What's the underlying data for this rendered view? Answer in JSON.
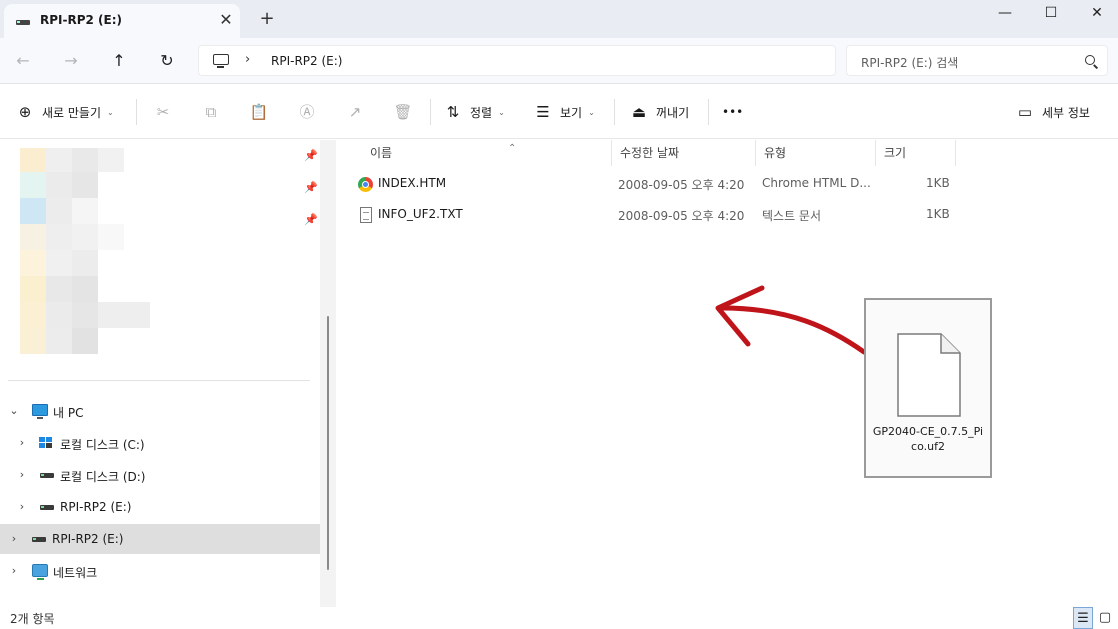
{
  "tab": {
    "title": "RPI-RP2 (E:)",
    "close_glyph": "✕",
    "new_tab_glyph": "+"
  },
  "window": {
    "minimize_glyph": "—",
    "maximize_glyph": "☐",
    "close_glyph": "✕"
  },
  "address": {
    "crumbs": [
      "RPI-RP2 (E:)"
    ],
    "search_placeholder": "RPI-RP2 (E:) 검색"
  },
  "commands": {
    "new_label": "새로 만들기",
    "sort_label": "정렬",
    "view_label": "보기",
    "eject_label": "꺼내기",
    "more_glyph": "•••",
    "details_label": "세부 정보"
  },
  "nav_tree": [
    {
      "label": "내 PC",
      "icon": "pc-icon",
      "expanded": true
    },
    {
      "label": "로컬 디스크 (C:)",
      "icon": "windows-drive-icon"
    },
    {
      "label": "로컬 디스크 (D:)",
      "icon": "drive-icon"
    },
    {
      "label": "RPI-RP2 (E:)",
      "icon": "drive-icon"
    },
    {
      "label": "RPI-RP2 (E:)",
      "icon": "drive-icon",
      "selected": true
    },
    {
      "label": "네트워크",
      "icon": "network-icon"
    }
  ],
  "columns": {
    "name": "이름",
    "modified": "수정한 날짜",
    "type": "유형",
    "size": "크기"
  },
  "files": [
    {
      "name": "INDEX.HTM",
      "modified": "2008-09-05 오후 4:20",
      "type": "Chrome HTML D...",
      "size": "1KB",
      "icon": "chrome-icon"
    },
    {
      "name": "INFO_UF2.TXT",
      "modified": "2008-09-05 오후 4:20",
      "type": "텍스트 문서",
      "size": "1KB",
      "icon": "text-file-icon"
    }
  ],
  "dragged_file": {
    "name": "GP2040-CE_0.7.5_Pico.uf2"
  },
  "status": {
    "item_count": "2개 항목"
  },
  "colors": {
    "arrow": "#c0141b",
    "selection": "#dedede",
    "tabbar": "#e9edf3"
  }
}
